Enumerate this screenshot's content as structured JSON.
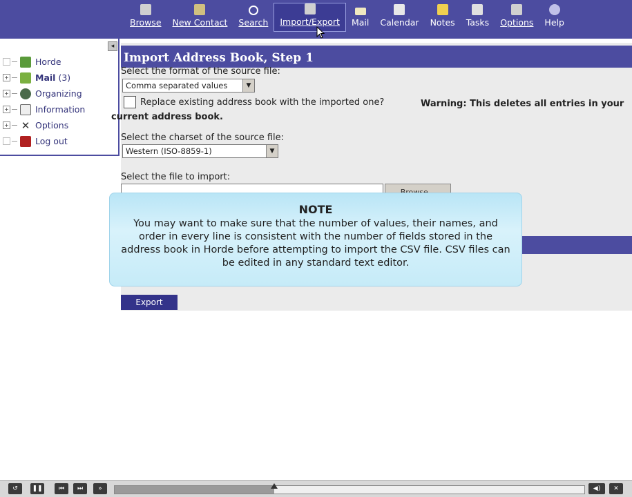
{
  "toolbar": {
    "items": [
      {
        "label": "Browse",
        "icon": "browse-icon",
        "color": "#d0d0d0"
      },
      {
        "label": "New Contact",
        "icon": "new-contact-icon",
        "color": "#d0c080"
      },
      {
        "label": "Search",
        "icon": "search-icon",
        "color": "#ffffff"
      },
      {
        "label": "Import/Export",
        "icon": "import-export-icon",
        "color": "#d0d0d0",
        "active": true
      },
      {
        "label": "Mail",
        "icon": "mail-icon",
        "color": "#f0e8c0"
      },
      {
        "label": "Calendar",
        "icon": "calendar-icon",
        "color": "#e8e8e8"
      },
      {
        "label": "Notes",
        "icon": "notes-icon",
        "color": "#f0d050"
      },
      {
        "label": "Tasks",
        "icon": "tasks-icon",
        "color": "#e0e0e0"
      },
      {
        "label": "Options",
        "icon": "options-icon",
        "color": "#d0d0d0"
      },
      {
        "label": "Help",
        "icon": "help-icon",
        "color": "#c0c0e8"
      }
    ]
  },
  "sidebar": {
    "items": [
      {
        "label": "Horde",
        "icon": "horde-icon",
        "color": "#5a9a3a"
      },
      {
        "label": "Mail",
        "count": "(3)",
        "icon": "mail-folder-icon",
        "color": "#7ab040"
      },
      {
        "label": "Organizing",
        "icon": "organizing-icon",
        "color": "#4a6a4a"
      },
      {
        "label": "Information",
        "icon": "information-icon",
        "color": "#bbbbbb"
      },
      {
        "label": "Options",
        "icon": "options-icon",
        "color": "#333333"
      },
      {
        "label": "Log out",
        "icon": "logout-icon",
        "color": "#b02020"
      }
    ]
  },
  "main": {
    "title": "Import Address Book, Step 1",
    "format_label": "Select the format of the source file:",
    "format_value": "Comma separated values",
    "replace_label": "Replace existing address book with the imported one?",
    "warning_text": "Warning: This deletes all entries in your current address book.",
    "charset_label": "Select the charset of the source file:",
    "charset_value": "Western (ISO-8859-1)",
    "file_label": "Select the file to import:",
    "browse_label": "Browse...",
    "export_label": "Export"
  },
  "note": {
    "title": "NOTE",
    "body": "You may want to make sure that the number of values, their names, and order in every line is consistent with the number of fields stored in the address book in Horde before attempting to import the CSV file. CSV files can be edited in any standard text editor."
  },
  "player": {
    "progress": 0.34,
    "buttons": [
      "replay",
      "pause",
      "previous",
      "next",
      "forward"
    ],
    "volume_icon": "volume-icon",
    "close_icon": "close-icon"
  },
  "colors": {
    "header": "#4c4ca0",
    "content_bg": "#ebebeb",
    "note_bg": "#c6ebf8"
  }
}
